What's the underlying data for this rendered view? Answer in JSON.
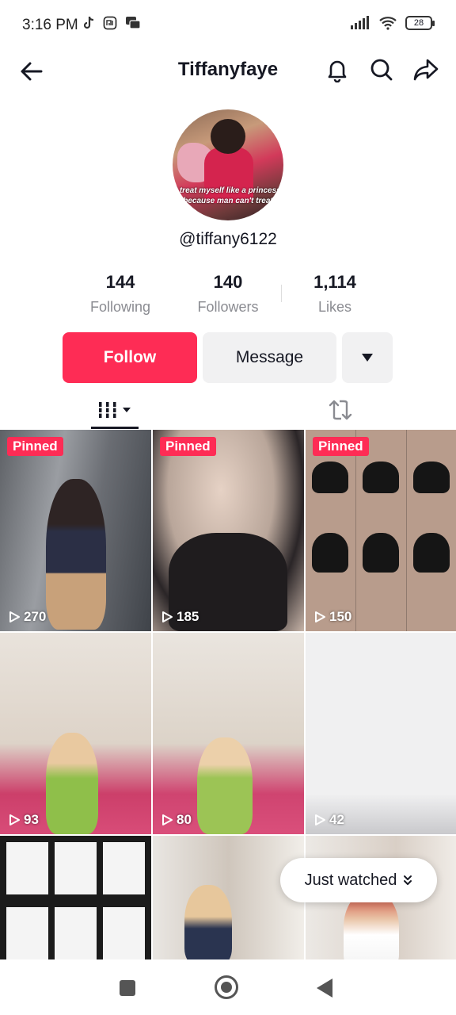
{
  "status_bar": {
    "time": "3:16 PM",
    "battery": "28"
  },
  "header": {
    "title": "Tiffanyfaye"
  },
  "profile": {
    "username": "@tiffany6122",
    "avatar_caption": "I treat myself like a princess because man can't treat"
  },
  "stats": [
    {
      "value": "144",
      "label": "Following"
    },
    {
      "value": "140",
      "label": "Followers"
    },
    {
      "value": "1,114",
      "label": "Likes"
    }
  ],
  "actions": {
    "follow": "Follow",
    "message": "Message"
  },
  "videos": [
    {
      "pinned": "Pinned",
      "views": "270"
    },
    {
      "pinned": "Pinned",
      "views": "185"
    },
    {
      "pinned": "Pinned",
      "views": "150"
    },
    {
      "views": "93"
    },
    {
      "views": "80"
    },
    {
      "views": "42"
    }
  ],
  "just_watched": "Just watched",
  "colors": {
    "accent": "#fe2c55",
    "secondary_button": "#f1f1f2",
    "muted_text": "#8a8b91"
  },
  "icons": [
    "back-arrow-icon",
    "bell-icon",
    "search-icon",
    "share-icon",
    "grid-icon",
    "repost-icon",
    "play-icon",
    "dropdown-icon"
  ]
}
